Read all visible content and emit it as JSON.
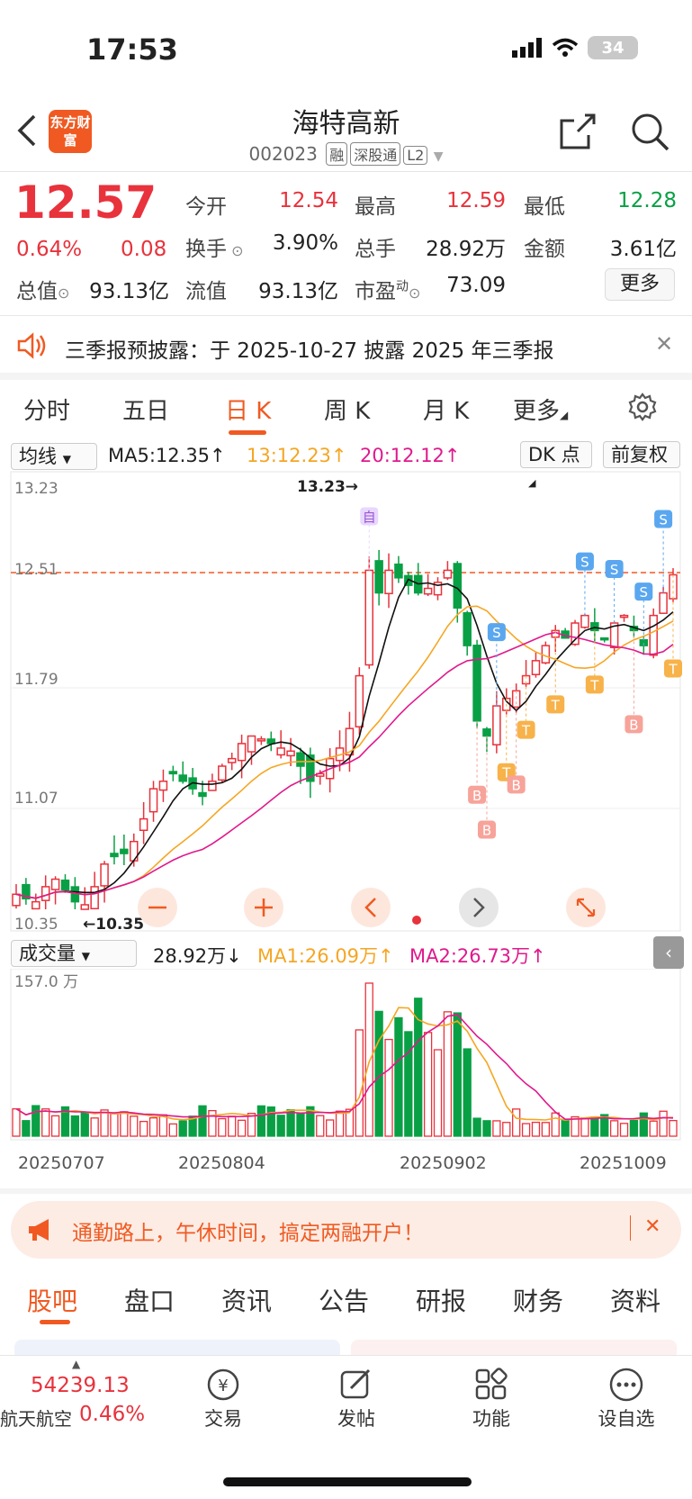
{
  "status": {
    "time": "17:53",
    "battery": "34"
  },
  "header": {
    "logo": "东方财富",
    "title": "海特高新",
    "code": "002023",
    "tags": [
      "融",
      "深股通",
      "L2"
    ]
  },
  "quote": {
    "price": "12.57",
    "change_pct": "0.64%",
    "change": "0.08",
    "fields": [
      {
        "label": "今开",
        "value": "12.54",
        "color": "red"
      },
      {
        "label": "最高",
        "value": "12.59",
        "color": "red"
      },
      {
        "label": "最低",
        "value": "12.28",
        "color": "green"
      },
      {
        "label": "换手",
        "value": "3.90%",
        "color": "dark"
      },
      {
        "label": "总手",
        "value": "28.92万",
        "color": "dark"
      },
      {
        "label": "金额",
        "value": "3.61亿",
        "color": "dark"
      },
      {
        "label": "总值",
        "value": "93.13亿",
        "color": "dark"
      },
      {
        "label": "流值",
        "value": "93.13亿",
        "color": "dark"
      },
      {
        "label": "市盈",
        "value": "73.09",
        "color": "dark"
      }
    ],
    "pe_sup": "动",
    "more": "更多"
  },
  "notice": {
    "text": "三季报预披露：于 2025-10-27 披露 2025 年三季报"
  },
  "tabs": [
    "分时",
    "五日",
    "日 K",
    "周 K",
    "月 K",
    "更多",
    ""
  ],
  "chart_controls": {
    "indicator": "均线",
    "ma5": "MA5:12.35↑",
    "ma13": "13:12.23↑",
    "ma20": "20:12.12↑",
    "dk": "DK 点",
    "adjust": "前复权"
  },
  "volume_controls": {
    "indicator": "成交量",
    "vol": "28.92万↓",
    "ma1": "MA1:26.09万↑",
    "ma2": "MA2:26.73万↑",
    "top_label": "157.0 万"
  },
  "chart_data": {
    "type": "candlestick",
    "y_ticks": [
      "13.23",
      "12.51",
      "11.79",
      "11.07",
      "10.35"
    ],
    "ylim": [
      10.35,
      13.23
    ],
    "current_price_line": 12.51,
    "max_label": "13.23→",
    "min_label": "←10.35",
    "x_labels": [
      "20250707",
      "20250804",
      "20250902",
      "20251009"
    ],
    "signals": {
      "buy": "B",
      "sell": "S",
      "take": "T",
      "self": "自"
    }
  },
  "promo": {
    "text": "通勤路上，午休时间，搞定两融开户！"
  },
  "bottom_tabs": [
    "股吧",
    "盘口",
    "资讯",
    "公告",
    "研报",
    "财务",
    "资料"
  ],
  "dock": {
    "index_value": "54239.13",
    "index_name": "航天航空",
    "index_change": "0.46%",
    "items": [
      "交易",
      "发帖",
      "功能",
      "设自选"
    ]
  },
  "colors": {
    "accent": "#f05a22",
    "up": "#e8323c",
    "down": "#09a045"
  }
}
